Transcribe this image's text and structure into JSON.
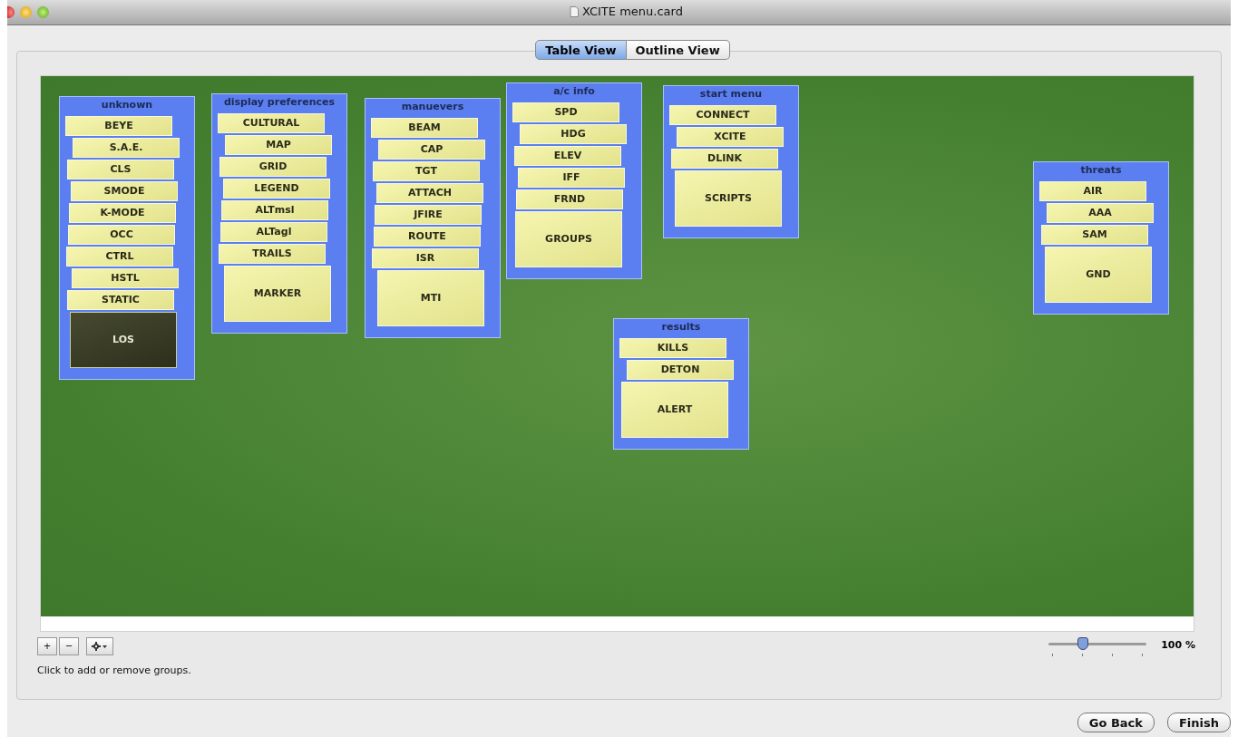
{
  "window": {
    "title": "XCITE menu.card"
  },
  "tabs": [
    {
      "label": "Table View",
      "selected": true
    },
    {
      "label": "Outline View",
      "selected": false
    }
  ],
  "groups": [
    {
      "title": "unknown",
      "cards": [
        {
          "label": "BEYE",
          "selected": false
        },
        {
          "label": "S.A.E.",
          "selected": false
        },
        {
          "label": "CLS",
          "selected": false
        },
        {
          "label": "SMODE",
          "selected": false
        },
        {
          "label": "K-MODE",
          "selected": false
        },
        {
          "label": "OCC",
          "selected": false
        },
        {
          "label": "CTRL",
          "selected": false
        },
        {
          "label": "HSTL",
          "selected": false
        },
        {
          "label": "STATIC",
          "selected": false
        },
        {
          "label": "LOS",
          "selected": true
        }
      ]
    },
    {
      "title": "display preferences",
      "cards": [
        {
          "label": "CULTURAL",
          "selected": false
        },
        {
          "label": "MAP",
          "selected": false
        },
        {
          "label": "GRID",
          "selected": false
        },
        {
          "label": "LEGEND",
          "selected": false
        },
        {
          "label": "ALTmsl",
          "selected": false
        },
        {
          "label": "ALTagl",
          "selected": false
        },
        {
          "label": "TRAILS",
          "selected": false
        },
        {
          "label": "MARKER",
          "selected": false
        }
      ]
    },
    {
      "title": "manuevers",
      "cards": [
        {
          "label": "BEAM",
          "selected": false
        },
        {
          "label": "CAP",
          "selected": false
        },
        {
          "label": "TGT",
          "selected": false
        },
        {
          "label": "ATTACH",
          "selected": false
        },
        {
          "label": "JFIRE",
          "selected": false
        },
        {
          "label": "ROUTE",
          "selected": false
        },
        {
          "label": "ISR",
          "selected": false
        },
        {
          "label": "MTI",
          "selected": false
        }
      ]
    },
    {
      "title": "a/c info",
      "cards": [
        {
          "label": "SPD",
          "selected": false
        },
        {
          "label": "HDG",
          "selected": false
        },
        {
          "label": "ELEV",
          "selected": false
        },
        {
          "label": "IFF",
          "selected": false
        },
        {
          "label": "FRND",
          "selected": false
        },
        {
          "label": "GROUPS",
          "selected": false
        }
      ]
    },
    {
      "title": "start menu",
      "cards": [
        {
          "label": "CONNECT",
          "selected": false
        },
        {
          "label": "XCITE",
          "selected": false
        },
        {
          "label": "DLINK",
          "selected": false
        },
        {
          "label": "SCRIPTS",
          "selected": false
        }
      ]
    },
    {
      "title": "results",
      "cards": [
        {
          "label": "KILLS",
          "selected": false
        },
        {
          "label": "DETON",
          "selected": false
        },
        {
          "label": "ALERT",
          "selected": false
        }
      ]
    },
    {
      "title": "threats",
      "cards": [
        {
          "label": "AIR",
          "selected": false
        },
        {
          "label": "AAA",
          "selected": false
        },
        {
          "label": "SAM",
          "selected": false
        },
        {
          "label": "GND",
          "selected": false
        }
      ]
    }
  ],
  "toolbar": {
    "add": "+",
    "remove": "−",
    "hint": "Click to add or remove groups."
  },
  "zoom": {
    "level": 0.35,
    "reading": "100 %"
  },
  "buttons": [
    "Go Back",
    "Finish"
  ]
}
